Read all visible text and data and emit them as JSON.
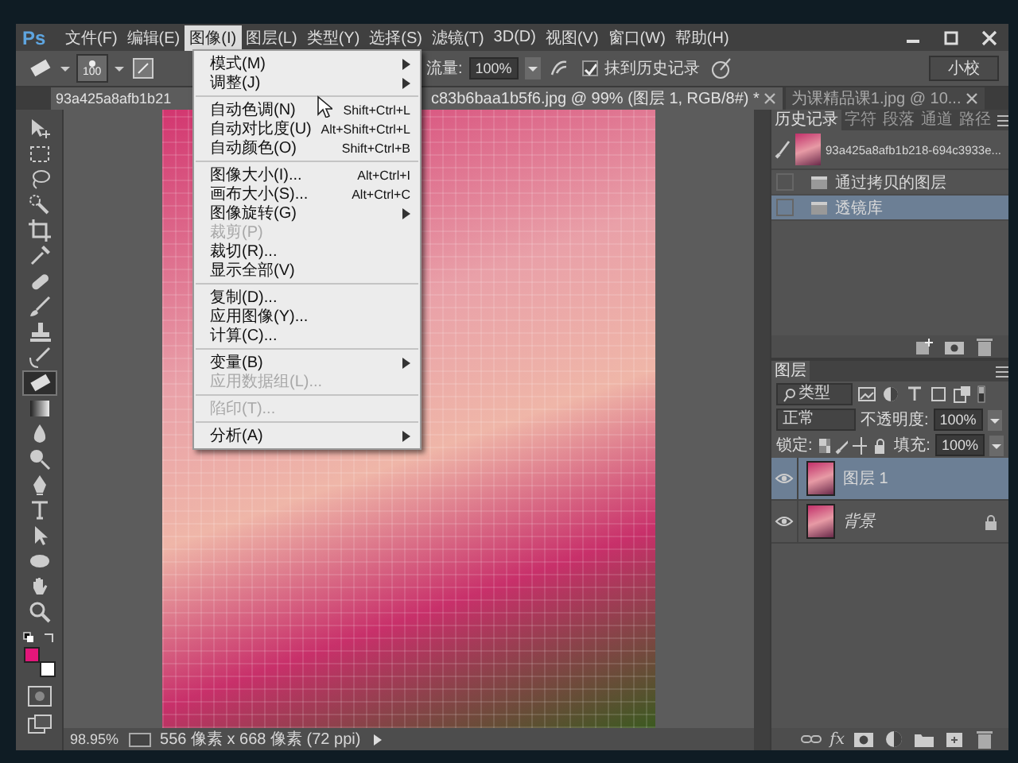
{
  "logo": "Ps",
  "menubar": {
    "items": [
      {
        "label": "文件(F)",
        "selected": false
      },
      {
        "label": "编辑(E)",
        "selected": false
      },
      {
        "label": "图像(I)",
        "selected": true
      },
      {
        "label": "图层(L)",
        "selected": false
      },
      {
        "label": "类型(Y)",
        "selected": false
      },
      {
        "label": "选择(S)",
        "selected": false
      },
      {
        "label": "滤镜(T)",
        "selected": false
      },
      {
        "label": "3D(D)",
        "selected": false
      },
      {
        "label": "视图(V)",
        "selected": false
      },
      {
        "label": "窗口(W)",
        "selected": false
      },
      {
        "label": "帮助(H)",
        "selected": false
      }
    ]
  },
  "options": {
    "brush_size": "100",
    "flow_label": "流量:",
    "flow_value": "100%",
    "erase_to_history": {
      "label": "抹到历史记录",
      "checked": true
    },
    "workspace": "小校"
  },
  "doc_tabs": [
    {
      "title_parts": [
        "93a425a8afb1b21",
        "c83b6baa1b5f6.jpg @ 99% (图层 1, RGB/8#) *"
      ],
      "selected": true
    },
    {
      "title_parts": [
        "为课精品课1.jpg @ 10..."
      ],
      "selected": false
    }
  ],
  "tools": [
    {
      "selected": false
    },
    {
      "selected": false
    },
    {
      "selected": false
    },
    {
      "selected": false
    },
    {
      "selected": false
    },
    {
      "selected": false
    },
    {
      "selected": false
    },
    {
      "selected": false
    },
    {
      "selected": false
    },
    {
      "selected": false
    },
    {
      "selected": true
    },
    {
      "selected": false
    },
    {
      "selected": false
    },
    {
      "selected": false
    },
    {
      "selected": false
    },
    {
      "selected": false
    },
    {
      "selected": false
    },
    {
      "selected": false
    },
    {
      "selected": false
    },
    {
      "selected": false
    }
  ],
  "swatches": [
    {
      "color": "#e3167a"
    },
    {
      "color": "#ffffff"
    }
  ],
  "image_menu": {
    "items": [
      {
        "kind": "item",
        "label": "模式(M)",
        "submenu": true,
        "disabled": false
      },
      {
        "kind": "item",
        "label": "调整(J)",
        "submenu": true,
        "disabled": false
      },
      {
        "kind": "separator"
      },
      {
        "kind": "item",
        "label": "自动色调(N)",
        "shortcut": "Shift+Ctrl+L",
        "submenu": false,
        "disabled": false
      },
      {
        "kind": "item",
        "label": "自动对比度(U)",
        "shortcut": "Alt+Shift+Ctrl+L",
        "submenu": false,
        "disabled": false
      },
      {
        "kind": "item",
        "label": "自动颜色(O)",
        "shortcut": "Shift+Ctrl+B",
        "submenu": false,
        "disabled": false
      },
      {
        "kind": "separator"
      },
      {
        "kind": "item",
        "label": "图像大小(I)...",
        "shortcut": "Alt+Ctrl+I",
        "submenu": false,
        "disabled": false
      },
      {
        "kind": "item",
        "label": "画布大小(S)...",
        "shortcut": "Alt+Ctrl+C",
        "submenu": false,
        "disabled": false
      },
      {
        "kind": "item",
        "label": "图像旋转(G)",
        "submenu": true,
        "disabled": false
      },
      {
        "kind": "item",
        "label": "裁剪(P)",
        "submenu": false,
        "disabled": true
      },
      {
        "kind": "item",
        "label": "裁切(R)...",
        "submenu": false,
        "disabled": false
      },
      {
        "kind": "item",
        "label": "显示全部(V)",
        "submenu": false,
        "disabled": false
      },
      {
        "kind": "separator"
      },
      {
        "kind": "item",
        "label": "复制(D)...",
        "submenu": false,
        "disabled": false
      },
      {
        "kind": "item",
        "label": "应用图像(Y)...",
        "submenu": false,
        "disabled": false
      },
      {
        "kind": "item",
        "label": "计算(C)...",
        "submenu": false,
        "disabled": false
      },
      {
        "kind": "separator"
      },
      {
        "kind": "item",
        "label": "变量(B)",
        "submenu": true,
        "disabled": false
      },
      {
        "kind": "item",
        "label": "应用数据组(L)...",
        "submenu": false,
        "disabled": true
      },
      {
        "kind": "separator"
      },
      {
        "kind": "item",
        "label": "陷印(T)...",
        "submenu": false,
        "disabled": true
      },
      {
        "kind": "separator"
      },
      {
        "kind": "item",
        "label": "分析(A)",
        "submenu": true,
        "disabled": false
      }
    ]
  },
  "status_bar": {
    "zoom": "98.95%",
    "doc_info": "556 像素 x 668 像素 (72 ppi)"
  },
  "history_panel": {
    "tabs": [
      {
        "label": "历史记录",
        "selected": true
      },
      {
        "label": "字符",
        "selected": false
      },
      {
        "label": "段落",
        "selected": false
      },
      {
        "label": "通道",
        "selected": false
      },
      {
        "label": "路径",
        "selected": false
      }
    ],
    "snapshot": "93a425a8afb1b218-694c3933e...",
    "items": [
      {
        "label": "通过拷贝的图层",
        "selected": false
      },
      {
        "label": "透镜库",
        "selected": true
      }
    ]
  },
  "layers_panel": {
    "tab": "图层",
    "filter": "类型",
    "blend_mode": "正常",
    "opacity_label": "不透明度:",
    "opacity": "100%",
    "lock_label": "锁定:",
    "fill_label": "填充:",
    "fill": "100%",
    "fx_button": "fx",
    "layers": [
      {
        "name": "图层 1",
        "selected": true,
        "visible": true,
        "locked": false,
        "italic": false
      },
      {
        "name": "背景",
        "selected": false,
        "visible": true,
        "locked": true,
        "italic": true
      }
    ]
  }
}
